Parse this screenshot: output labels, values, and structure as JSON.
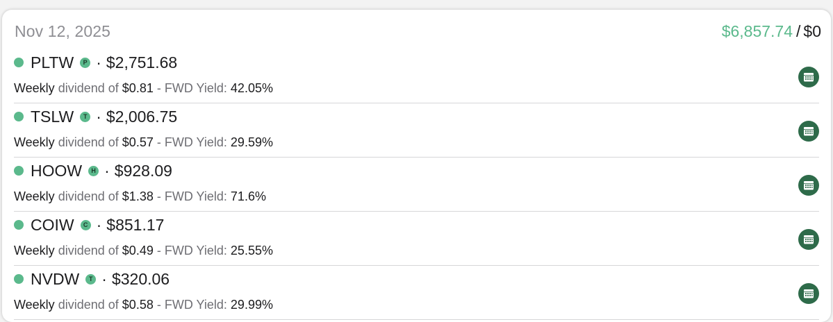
{
  "header": {
    "date": "Nov 12, 2025",
    "total_amount": "$6,857.74",
    "separator": "/",
    "secondary_amount": "$0"
  },
  "colors": {
    "accent_green": "#5bb98c",
    "icon_button_green": "#2e6b4a"
  },
  "labels": {
    "frequency": "Weekly",
    "dividend_of": "dividend of",
    "dash": "-",
    "fwd_yield": "FWD Yield:",
    "bullet": "·"
  },
  "holdings": [
    {
      "ticker": "PLTW",
      "badge": "P",
      "value": "$2,751.68",
      "dividend": "$0.81",
      "yield": "42.05%",
      "icon": "calendar-icon"
    },
    {
      "ticker": "TSLW",
      "badge": "T",
      "value": "$2,006.75",
      "dividend": "$0.57",
      "yield": "29.59%",
      "icon": "calendar-icon"
    },
    {
      "ticker": "HOOW",
      "badge": "H",
      "value": "$928.09",
      "dividend": "$1.38",
      "yield": "71.6%",
      "icon": "calendar-icon"
    },
    {
      "ticker": "COIW",
      "badge": "C",
      "value": "$851.17",
      "dividend": "$0.49",
      "yield": "25.55%",
      "icon": "calendar-icon"
    },
    {
      "ticker": "NVDW",
      "badge": "T",
      "value": "$320.06",
      "dividend": "$0.58",
      "yield": "29.99%",
      "icon": "calendar-icon"
    }
  ]
}
